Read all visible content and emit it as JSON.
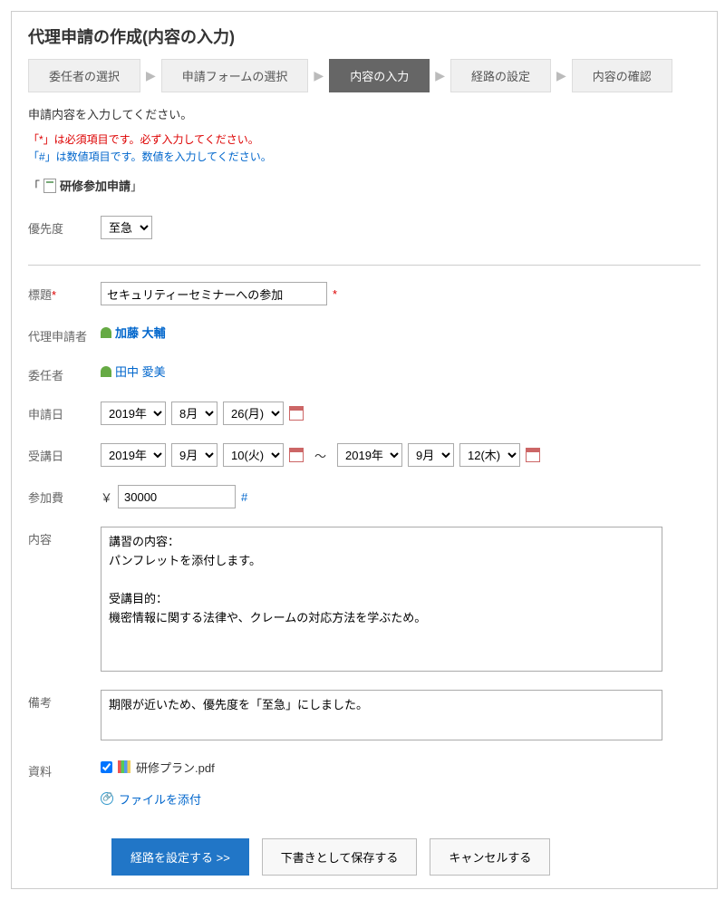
{
  "page_title": "代理申請の作成(内容の入力)",
  "steps": [
    "委任者の選択",
    "申請フォームの選択",
    "内容の入力",
    "経路の設定",
    "内容の確認"
  ],
  "active_step_index": 2,
  "intro": "申請内容を入力してください。",
  "legend_required": "「*」は必須項目です。必ず入力してください。",
  "legend_numeric": "「#」は数値項目です。数値を入力してください。",
  "form_title_prefix": "「",
  "form_title": "研修参加申請",
  "form_title_suffix": "」",
  "fields": {
    "priority_label": "優先度",
    "priority_value": "至急",
    "subject_label": "標題",
    "subject_value": "セキュリティーセミナーへの参加",
    "proxy_label": "代理申請者",
    "proxy_name": "加藤 大輔",
    "delegator_label": "委任者",
    "delegator_name": "田中 愛美",
    "apply_date_label": "申請日",
    "apply_year": "2019年",
    "apply_month": "8月",
    "apply_day": "26(月)",
    "course_date_label": "受講日",
    "start_year": "2019年",
    "start_month": "9月",
    "start_day": "10(火)",
    "range_sep": "～",
    "end_year": "2019年",
    "end_month": "9月",
    "end_day": "12(木)",
    "fee_label": "参加費",
    "fee_currency": "￥",
    "fee_value": "30000",
    "content_label": "内容",
    "content_value": "講習の内容：\nパンフレットを添付します。\n\n受講目的：\n機密情報に関する法律や、クレームの対応方法を学ぶため。",
    "notes_label": "備考",
    "notes_value": "期限が近いため、優先度を「至急」にしました。",
    "attachment_label": "資料",
    "attachment_filename": "研修プラン.pdf",
    "attach_link": "ファイルを添付"
  },
  "buttons": {
    "primary": "経路を設定する >>",
    "save_draft": "下書きとして保存する",
    "cancel": "キャンセルする"
  }
}
